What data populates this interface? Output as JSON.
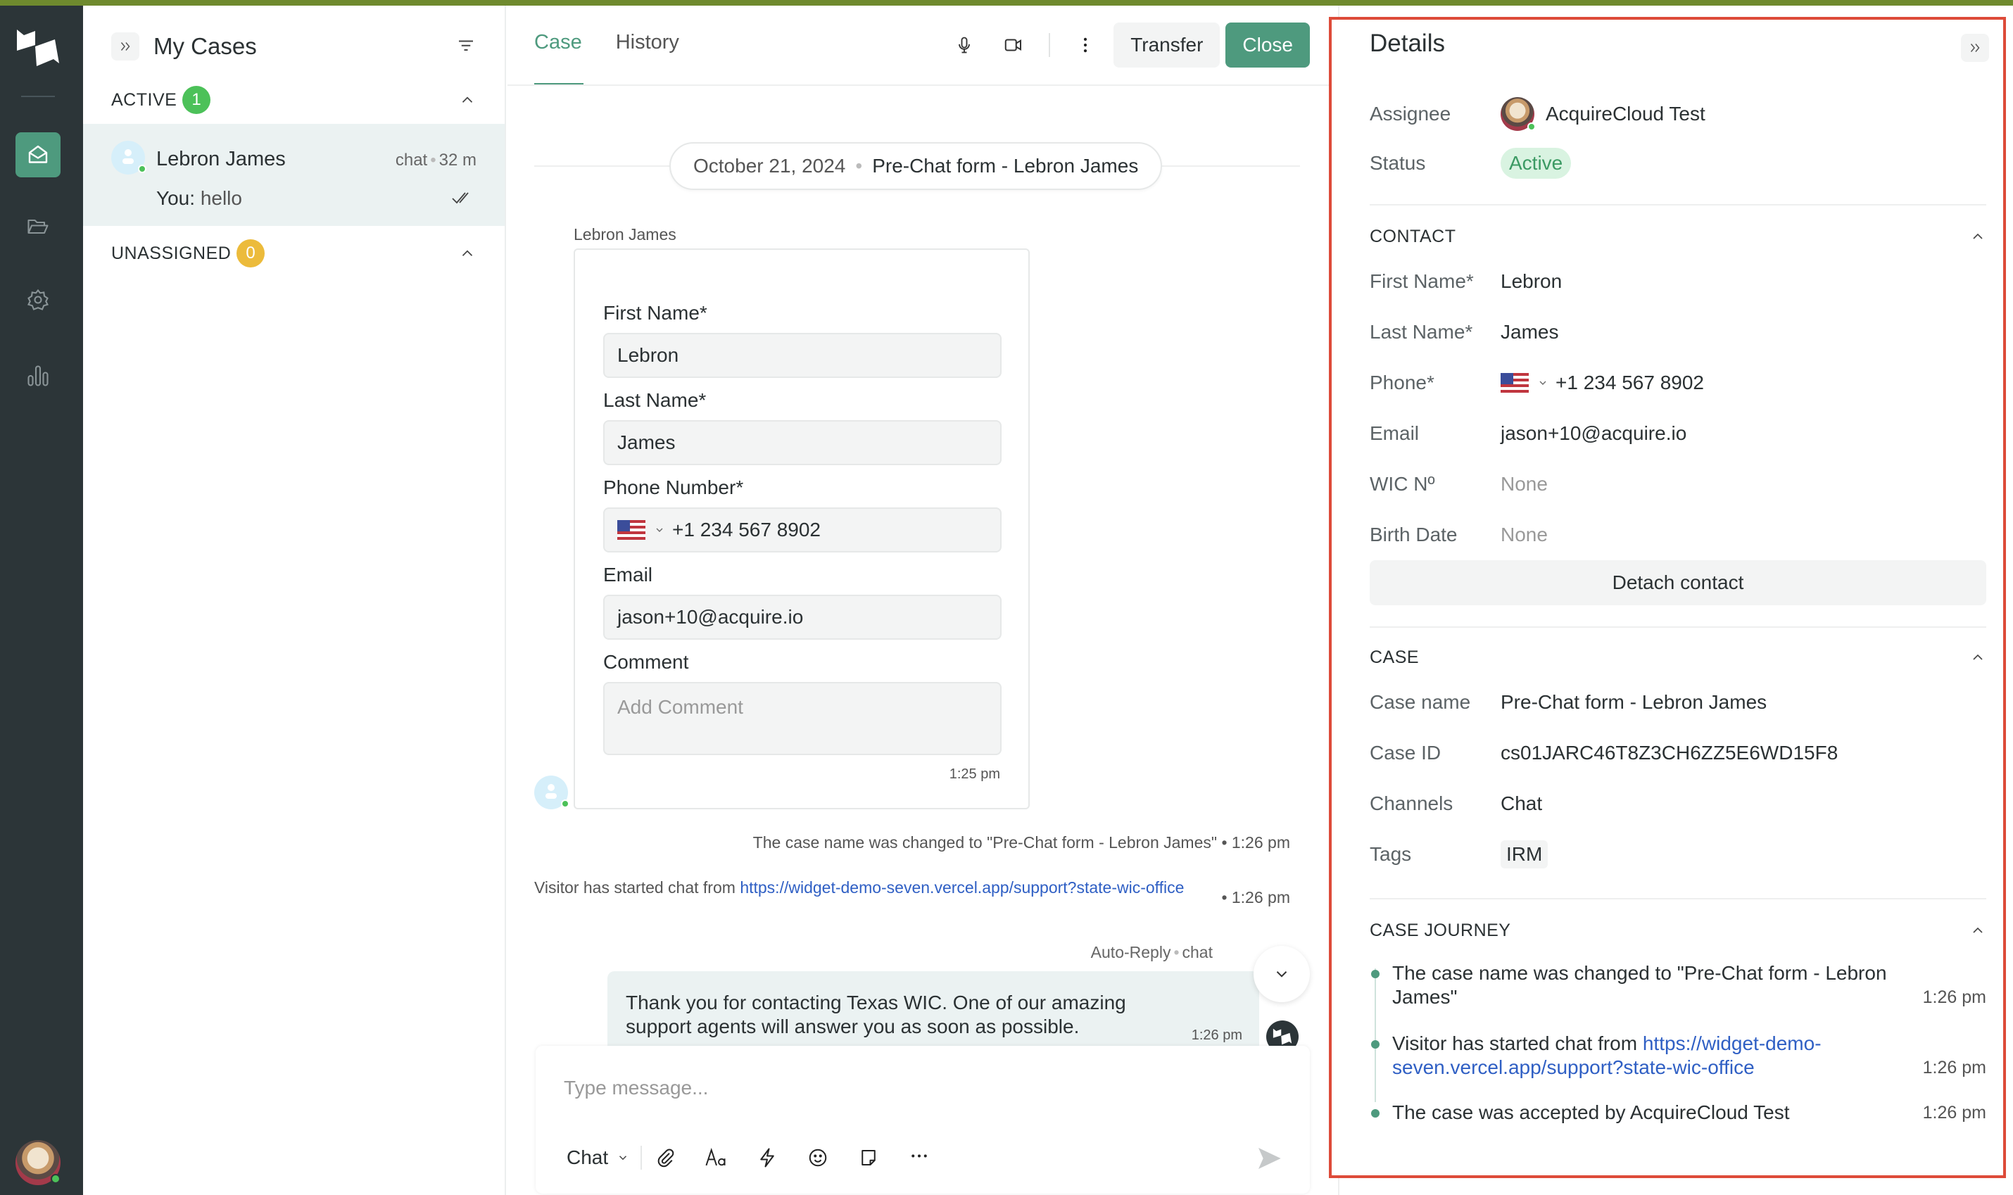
{
  "app": {
    "accent_color": "#4e9a7e",
    "rail_color": "#2c3538"
  },
  "rail": {
    "items": [
      {
        "name": "inbox",
        "icon": "inbox-envelope-icon",
        "active": true
      },
      {
        "name": "cases-folder",
        "icon": "folder-open-icon",
        "active": false
      },
      {
        "name": "settings",
        "icon": "gear-icon",
        "active": false
      },
      {
        "name": "analytics",
        "icon": "bar-chart-icon",
        "active": false
      }
    ],
    "user_status": "online"
  },
  "cases_panel": {
    "title": "My Cases",
    "sections": [
      {
        "label": "ACTIVE",
        "count": "1",
        "badge_color": "#4cc159"
      },
      {
        "label": "UNASSIGNED",
        "count": "0",
        "badge_color": "#ecbb3b"
      }
    ],
    "active_cases": [
      {
        "name": "Lebron James",
        "channel": "chat",
        "age": "32 m",
        "preview_prefix": "You:",
        "preview_text": "hello",
        "read": true
      }
    ]
  },
  "main": {
    "tabs": [
      {
        "label": "Case",
        "active": true
      },
      {
        "label": "History",
        "active": false
      }
    ],
    "toolbar": {
      "transfer_label": "Transfer",
      "close_label": "Close"
    },
    "date_pill": {
      "date": "October 21, 2024",
      "case_name": "Pre-Chat form - Lebron James"
    },
    "form_message": {
      "sender": "Lebron James",
      "time": "1:25 pm",
      "fields": {
        "first_name_label": "First Name*",
        "first_name_value": "Lebron",
        "last_name_label": "Last Name*",
        "last_name_value": "James",
        "phone_label": "Phone Number*",
        "phone_value": "+1 234 567 8902",
        "email_label": "Email",
        "email_value": "jason+10@acquire.io",
        "comment_label": "Comment",
        "comment_placeholder": "Add Comment"
      }
    },
    "system_messages": [
      {
        "text": "The case name was changed to \"Pre-Chat form - Lebron James\"",
        "time": "• 1:26 pm"
      },
      {
        "text": "Visitor has started chat from ",
        "link": "https://widget-demo-seven.vercel.app/support?state-wic-office",
        "time": "• 1:26 pm"
      }
    ],
    "auto_reply": {
      "sender": "Auto-Reply",
      "channel": "chat",
      "text": "Thank you for contacting Texas WIC. One of our amazing support agents will answer you as soon as possible.",
      "time": "1:26 pm"
    },
    "composer": {
      "placeholder": "Type message...",
      "channel": "Chat"
    }
  },
  "details": {
    "title": "Details",
    "assignee_label": "Assignee",
    "assignee_name": "AcquireCloud Test",
    "status_label": "Status",
    "status_value": "Active",
    "contact": {
      "heading": "CONTACT",
      "fields": [
        {
          "label": "First Name*",
          "value": "Lebron"
        },
        {
          "label": "Last Name*",
          "value": "James"
        },
        {
          "label": "Phone*",
          "value": "+1 234 567 8902"
        },
        {
          "label": "Email",
          "value": "jason+10@acquire.io"
        },
        {
          "label": "WIC Nº",
          "value": "None"
        },
        {
          "label": "Birth Date",
          "value": "None"
        }
      ],
      "detach_label": "Detach contact"
    },
    "case": {
      "heading": "CASE",
      "fields": [
        {
          "label": "Case name",
          "value": "Pre-Chat form - Lebron James"
        },
        {
          "label": "Case ID",
          "value": "cs01JARC46T8Z3CH6ZZ5E6WD15F8"
        },
        {
          "label": "Channels",
          "value": "Chat"
        },
        {
          "label": "Tags",
          "value": "IRM"
        }
      ]
    },
    "journey": {
      "heading": "CASE JOURNEY",
      "items": [
        {
          "text": "The case name was changed to \"Pre-Chat form - Lebron James\"",
          "link": "",
          "time": "1:26 pm"
        },
        {
          "text": "Visitor has started chat from ",
          "link": "https://widget-demo-seven.vercel.app/support?state-wic-office",
          "time": "1:26 pm"
        },
        {
          "text": "The case was accepted by AcquireCloud Test",
          "link": "",
          "time": "1:26 pm"
        }
      ]
    }
  }
}
